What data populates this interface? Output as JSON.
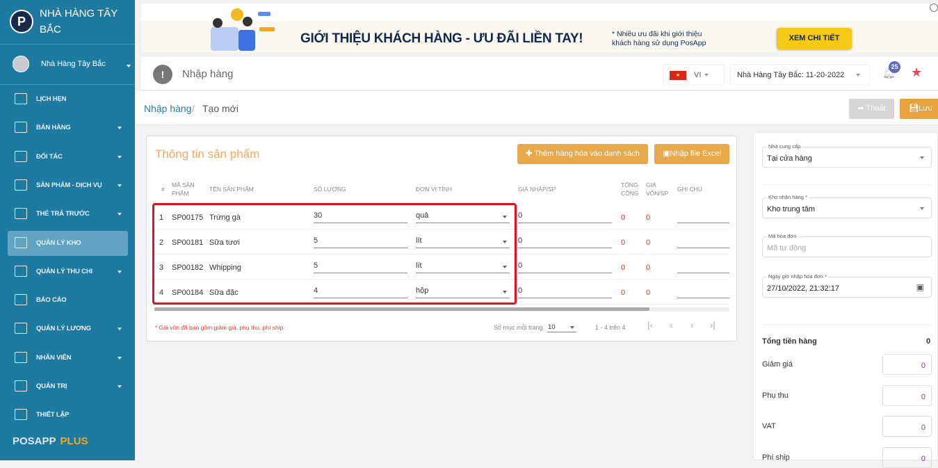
{
  "sidebar": {
    "brand": "NHÀ HÀNG TÂY BẮC",
    "user": "Nhà Hàng Tây Bắc",
    "items": [
      {
        "label": "LỊCH HẸN",
        "icon": "calendar-icon",
        "caret": false
      },
      {
        "label": "BÁN HÀNG",
        "icon": "cart-icon",
        "caret": true
      },
      {
        "label": "ĐỐI TÁC",
        "icon": "partners-icon",
        "caret": true
      },
      {
        "label": "SẢN PHẨM - DỊCH VỤ",
        "icon": "product-icon",
        "caret": true
      },
      {
        "label": "THẺ TRẢ TRƯỚC",
        "icon": "prepaid-card-icon",
        "caret": true
      },
      {
        "label": "QUẢN LÝ KHO",
        "icon": "box-icon",
        "caret": false,
        "active": true
      },
      {
        "label": "QUẢN LÝ THU CHI",
        "icon": "money-icon",
        "caret": true
      },
      {
        "label": "BÁO CÁO",
        "icon": "bar-chart-icon",
        "caret": false
      },
      {
        "label": "QUẢN LÝ LƯƠNG",
        "icon": "salary-card-icon",
        "caret": true
      },
      {
        "label": "NHÂN VIÊN",
        "icon": "employee-icon",
        "caret": true
      },
      {
        "label": "QUẢN TRỊ",
        "icon": "admin-icon",
        "caret": true
      },
      {
        "label": "THIẾT LẬP",
        "icon": "gear-icon",
        "caret": false
      }
    ],
    "footer_a": "POSAPP",
    "footer_b": "PLUS"
  },
  "banner": {
    "title": "GIỚI THIỆU KHÁCH HÀNG - ƯU ĐÃI LIỀN TAY!",
    "sub1": "* Nhiều ưu đãi khi giới thiệu",
    "sub2": "khách hàng sử dụng PosApp",
    "button": "XEM CHI TIẾT"
  },
  "header": {
    "title": "Nhập hàng",
    "lang": "VI",
    "store": "Nhà Hàng Tây Bắc: 11-20-2022",
    "notif_count": "25"
  },
  "breadcrumb": {
    "parent": "Nhập hàng",
    "sep": "/",
    "current": "Tạo mới"
  },
  "actions": {
    "exit": "Thoát",
    "save": "Lưu"
  },
  "card": {
    "title": "Thông tin sản phẩm",
    "add_btn": "Thêm hàng hóa vào danh sách",
    "excel_btn": "Nhập file Excel",
    "columns": [
      "#",
      "MÃ SẢN PHẨM",
      "TÊN SẢN PHẨM",
      "SỐ LƯỢNG",
      "ĐƠN VỊ TÍNH",
      "GIÁ NHẬP/SP",
      "TỔNG CỘNG",
      "GIÁ VỐN/SP",
      "GHI CHÚ"
    ],
    "rows": [
      {
        "n": "1",
        "code": "SP00175",
        "name": "Trứng gà",
        "qty": "30",
        "unit": "quả",
        "price": "0",
        "total": "0",
        "cost": "0",
        "note": ""
      },
      {
        "n": "2",
        "code": "SP00181",
        "name": "Sữa tươi",
        "qty": "5",
        "unit": "lít",
        "price": "0",
        "total": "0",
        "cost": "0",
        "note": ""
      },
      {
        "n": "3",
        "code": "SP00182",
        "name": "Whipping",
        "qty": "5",
        "unit": "lít",
        "price": "0",
        "total": "0",
        "cost": "0",
        "note": ""
      },
      {
        "n": "4",
        "code": "SP00184",
        "name": "Sữa đặc",
        "qty": "4",
        "unit": "hộp",
        "price": "0",
        "total": "0",
        "cost": "0",
        "note": ""
      }
    ],
    "note": "* Giá vốn đã bao gồm giảm giá, phụ thu, phí ship",
    "per_page_label": "Số mục mỗi trang",
    "per_page": "10",
    "range": "1 - 4 trên 4"
  },
  "panel": {
    "supplier_label": "Nhà cung cấp",
    "supplier": "Tại cửa hàng",
    "warehouse_label": "Kho nhận hàng *",
    "warehouse": "Kho trung tâm",
    "invoice_label": "Mã hóa đơn",
    "invoice_placeholder": "Mã tự động",
    "date_label": "Ngày giờ nhập hóa đơn *",
    "date": "27/10/2022, 21:32:17",
    "total_label": "Tổng tiền hàng",
    "total": "0",
    "discount_label": "Giảm giá",
    "discount": "0",
    "surcharge_label": "Phụ thu",
    "surcharge": "0",
    "vat_label": "VAT",
    "vat": "0",
    "ship_label": "Phí ship",
    "ship": "0"
  },
  "colors": {
    "sidebar": "#1f7aa2",
    "accent": "#e8a849",
    "highlight": "#e4121b"
  }
}
